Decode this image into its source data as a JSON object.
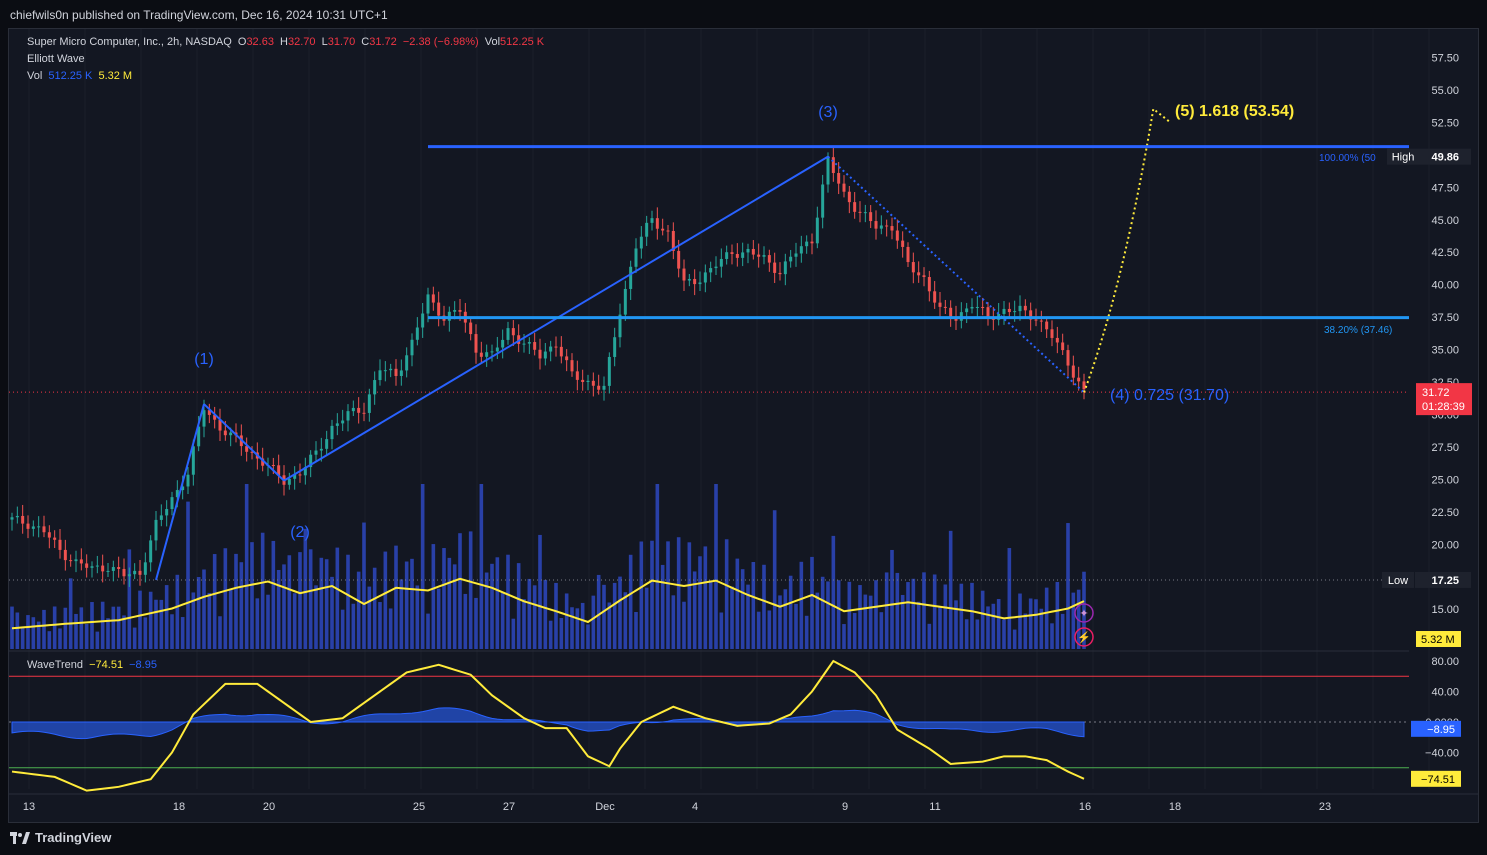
{
  "header": {
    "publisher_line": "chiefwils0n published on TradingView.com, Dec 16, 2024 10:31 UTC+1"
  },
  "legend": {
    "symbol_line": "Super Micro Computer, Inc., 2h, NASDAQ",
    "o_label": "O",
    "o_value": "32.63",
    "h_label": "H",
    "h_value": "32.70",
    "l_label": "L",
    "l_value": "31.70",
    "c_label": "C",
    "c_value": "31.72",
    "change": "−2.38 (−6.98%)",
    "vol_label": "Vol",
    "vol_value": "512.25 K",
    "indicator_1": "Elliott Wave",
    "vol_row_label": "Vol",
    "vol_row_value1": "512.25 K",
    "vol_row_value2": "5.32 M",
    "wavetrend_label": "WaveTrend",
    "wavetrend_value1": "−74.51",
    "wavetrend_value2": "−8.95"
  },
  "wave_labels": {
    "w1": "(1)",
    "w2": "(2)",
    "w3": "(3)",
    "w4": "(4) 0.725 (31.70)",
    "w5": "(5) 1.618 (53.54)"
  },
  "fib_labels": {
    "fib100": "100.00% (50",
    "fib382": "38.20% (37.46)"
  },
  "price_axis": {
    "ticks": [
      "57.50",
      "55.00",
      "52.50",
      "47.50",
      "45.00",
      "42.50",
      "40.00",
      "37.50",
      "35.00",
      "32.50",
      "30.00",
      "27.50",
      "25.00",
      "22.50",
      "20.00",
      "15.00"
    ],
    "high_tag": "High",
    "high_value": "49.86",
    "low_tag": "Low",
    "low_value": "17.25",
    "last_price": "31.72",
    "countdown": "01:28:39",
    "vol_tag": "5.32 M"
  },
  "osc_axis": {
    "ticks": [
      "80.00",
      "40.00",
      "0.0000",
      "−40.00"
    ],
    "tag1": "−8.95",
    "tag2": "−74.51"
  },
  "time_axis": [
    "13",
    "18",
    "20",
    "25",
    "27",
    "Dec",
    "4",
    "9",
    "11",
    "16",
    "18",
    "23"
  ],
  "footer": {
    "brand": "TradingView"
  },
  "colors": {
    "bg": "#131722",
    "up": "#26a69a",
    "down": "#ef5350",
    "wave": "#2962ff",
    "fib": "#2196f3",
    "projection": "#ffeb3b",
    "volume": "#2940a8",
    "wt_line": "#ffeb3b",
    "last_price": "#f23645"
  },
  "chart_data": {
    "type": "candlestick",
    "title": "Super Micro Computer, Inc., 2h, NASDAQ",
    "ylim": [
      12.5,
      60
    ],
    "x": [
      "13",
      "18",
      "20",
      "25",
      "27",
      "Dec",
      "4",
      "9",
      "11",
      "16",
      "18",
      "23"
    ],
    "price_path": [
      [
        0,
        21.9
      ],
      [
        3,
        21.6
      ],
      [
        6,
        21.0
      ],
      [
        9,
        19.5
      ],
      [
        12,
        18.6
      ],
      [
        15,
        18.1
      ],
      [
        18,
        18.3
      ],
      [
        21,
        17.6
      ],
      [
        24,
        17.8
      ],
      [
        27,
        21.5
      ],
      [
        30,
        23.5
      ],
      [
        33,
        25.5
      ],
      [
        36,
        30.5
      ],
      [
        39,
        29.0
      ],
      [
        42,
        28.0
      ],
      [
        45,
        27.0
      ],
      [
        48,
        26.0
      ],
      [
        51,
        24.9
      ],
      [
        54,
        25.5
      ],
      [
        57,
        27.0
      ],
      [
        60,
        29.0
      ],
      [
        63,
        30.0
      ],
      [
        66,
        30.5
      ],
      [
        69,
        33.5
      ],
      [
        72,
        33.0
      ],
      [
        75,
        35.5
      ],
      [
        78,
        39.0
      ],
      [
        81,
        37.5
      ],
      [
        84,
        38.0
      ],
      [
        87,
        35.0
      ],
      [
        90,
        34.5
      ],
      [
        93,
        36.5
      ],
      [
        96,
        35.5
      ],
      [
        99,
        34.5
      ],
      [
        102,
        35.5
      ],
      [
        105,
        33.0
      ],
      [
        108,
        32.5
      ],
      [
        111,
        32.0
      ],
      [
        114,
        38.0
      ],
      [
        117,
        43.0
      ],
      [
        120,
        45.0
      ],
      [
        123,
        44.0
      ],
      [
        126,
        40.0
      ],
      [
        129,
        40.5
      ],
      [
        132,
        41.5
      ],
      [
        135,
        42.5
      ],
      [
        138,
        42.5
      ],
      [
        141,
        42.0
      ],
      [
        144,
        41.0
      ],
      [
        147,
        42.5
      ],
      [
        150,
        43.5
      ],
      [
        153,
        49.5
      ],
      [
        156,
        47.0
      ],
      [
        159,
        45.5
      ],
      [
        162,
        44.5
      ],
      [
        165,
        44.5
      ],
      [
        168,
        41.5
      ],
      [
        171,
        40.5
      ],
      [
        174,
        38.0
      ],
      [
        177,
        37.5
      ],
      [
        180,
        38.5
      ],
      [
        183,
        37.5
      ],
      [
        186,
        38.0
      ],
      [
        189,
        38.0
      ],
      [
        192,
        37.5
      ],
      [
        195,
        36.0
      ],
      [
        198,
        34.0
      ],
      [
        201,
        31.72
      ]
    ],
    "volume_path_millions": [
      [
        0,
        2.3
      ],
      [
        10,
        2.8
      ],
      [
        20,
        3.2
      ],
      [
        30,
        4.5
      ],
      [
        36,
        5.8
      ],
      [
        42,
        6.8
      ],
      [
        48,
        7.5
      ],
      [
        54,
        6.2
      ],
      [
        60,
        7.0
      ],
      [
        66,
        5.0
      ],
      [
        72,
        6.8
      ],
      [
        78,
        6.5
      ],
      [
        84,
        7.8
      ],
      [
        90,
        6.8
      ],
      [
        96,
        5.3
      ],
      [
        102,
        4.2
      ],
      [
        108,
        3.0
      ],
      [
        114,
        5.4
      ],
      [
        120,
        7.6
      ],
      [
        126,
        7.0
      ],
      [
        132,
        7.6
      ],
      [
        138,
        6.0
      ],
      [
        144,
        4.7
      ],
      [
        150,
        6.0
      ],
      [
        156,
        4.2
      ],
      [
        162,
        4.7
      ],
      [
        168,
        5.2
      ],
      [
        174,
        4.7
      ],
      [
        180,
        4.2
      ],
      [
        186,
        3.4
      ],
      [
        192,
        3.8
      ],
      [
        198,
        4.5
      ],
      [
        201,
        5.32
      ]
    ],
    "volume_ma_value": "5.32 M",
    "elliott_waves": [
      {
        "label": "start",
        "x": 27,
        "y": 17.25
      },
      {
        "label": "(1)",
        "x": 36,
        "y": 30.8
      },
      {
        "label": "(2)",
        "x": 51,
        "y": 24.9
      },
      {
        "label": "(3)",
        "x": 153,
        "y": 49.86
      },
      {
        "label": "(4)",
        "x": 201,
        "y": 31.7
      },
      {
        "label": "(5)",
        "x": 214,
        "y": 53.54
      }
    ],
    "fib_levels": [
      {
        "ratio": "100.00%",
        "price": 49.86
      },
      {
        "ratio": "38.20%",
        "price": 37.46
      }
    ],
    "high": 49.86,
    "low": 17.25,
    "last": 31.72,
    "wavetrend": {
      "ylim": [
        -100,
        100
      ],
      "wt1_path": [
        [
          0,
          -65
        ],
        [
          8,
          -72
        ],
        [
          14,
          -90
        ],
        [
          20,
          -85
        ],
        [
          26,
          -75
        ],
        [
          30,
          -40
        ],
        [
          34,
          10
        ],
        [
          40,
          50
        ],
        [
          46,
          50
        ],
        [
          52,
          20
        ],
        [
          56,
          0
        ],
        [
          62,
          5
        ],
        [
          68,
          35
        ],
        [
          74,
          65
        ],
        [
          80,
          75
        ],
        [
          86,
          62
        ],
        [
          90,
          35
        ],
        [
          96,
          5
        ],
        [
          100,
          -8
        ],
        [
          104,
          -8
        ],
        [
          108,
          -45
        ],
        [
          112,
          -58
        ],
        [
          114,
          -35
        ],
        [
          118,
          0
        ],
        [
          124,
          20
        ],
        [
          130,
          5
        ],
        [
          136,
          -5
        ],
        [
          142,
          -2
        ],
        [
          146,
          10
        ],
        [
          150,
          40
        ],
        [
          154,
          80
        ],
        [
          158,
          65
        ],
        [
          162,
          35
        ],
        [
          166,
          -10
        ],
        [
          172,
          -35
        ],
        [
          176,
          -55
        ],
        [
          182,
          -52
        ],
        [
          186,
          -45
        ],
        [
          190,
          -45
        ],
        [
          194,
          -50
        ],
        [
          198,
          -65
        ],
        [
          201,
          -74.51
        ]
      ],
      "wt2_last": -8.95,
      "overbought": 60,
      "oversold": -60
    }
  }
}
